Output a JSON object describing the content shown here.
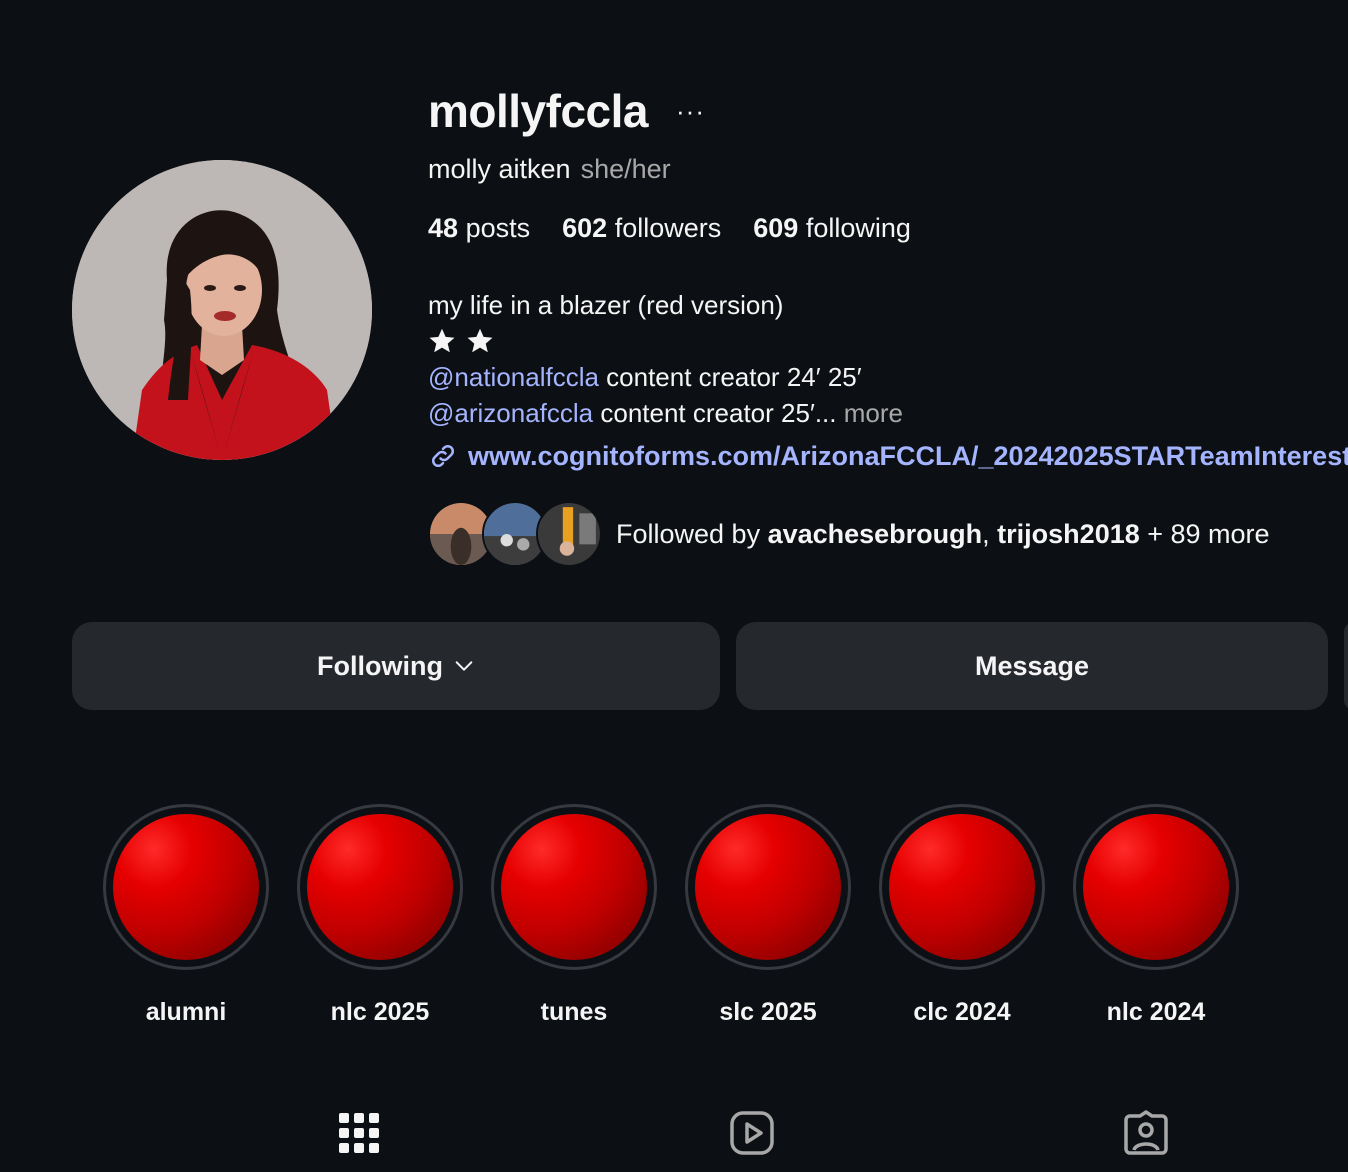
{
  "profile": {
    "username": "mollyfccla",
    "more_glyph": "···",
    "full_name": "molly aitken",
    "pronouns": "she/her"
  },
  "stats": {
    "posts_count": "48",
    "posts_label": "posts",
    "followers_count": "602",
    "followers_label": "followers",
    "following_count": "609",
    "following_label": "following"
  },
  "bio": {
    "line1": "my life in a blazer (red version)",
    "line2_stars": "★ ★",
    "mention1": "@nationalfccla",
    "mention1_text": " content creator 24′ 25′",
    "mention2": "@arizonafccla",
    "mention2_text": " content creator 25′...",
    "more": "more"
  },
  "link": {
    "url_text": "www.cognitoforms.com/ArizonaFCCLA/_20242025STARTeamInterest"
  },
  "followed_by": {
    "prefix": "Followed by ",
    "user1": "avachesebrough",
    "separator": ", ",
    "user2": "trijosh2018",
    "suffix": " + 89 more"
  },
  "actions": {
    "following_label": "Following",
    "message_label": "Message"
  },
  "highlights": [
    {
      "label": "alumni"
    },
    {
      "label": "nlc 2025"
    },
    {
      "label": "tunes"
    },
    {
      "label": "slc 2025"
    },
    {
      "label": "clc 2024"
    },
    {
      "label": "nlc 2024"
    }
  ],
  "tabs": [
    {
      "icon": "grid-icon"
    },
    {
      "icon": "reels-icon"
    },
    {
      "icon": "tagged-icon"
    }
  ],
  "colors": {
    "background": "#0c1014",
    "mention": "#a5b4ff",
    "button_bg": "#25292e",
    "muted": "#a8a8a8",
    "highlight_red": "#e60000"
  }
}
